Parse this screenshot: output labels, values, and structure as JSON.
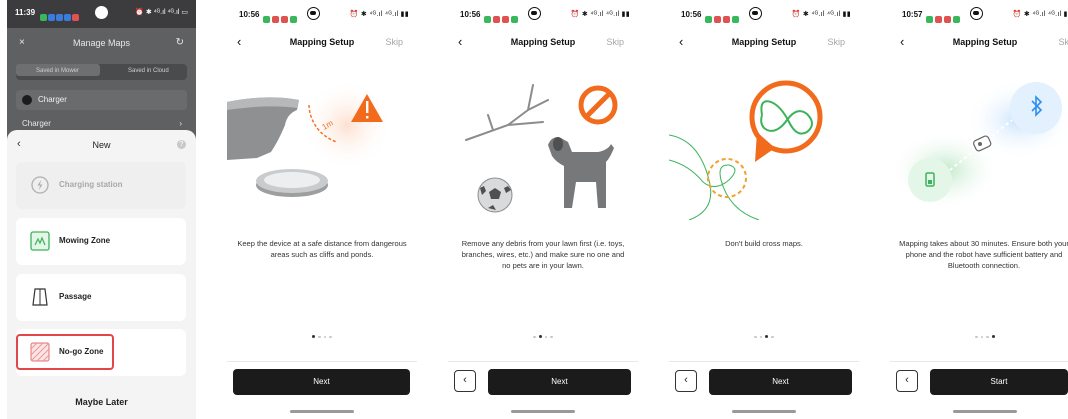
{
  "panel1": {
    "status": {
      "time": "11:39",
      "right": "⏰ ✱ ⁴ᴳ.ıl ⁴ᴳ.ıl ▭"
    },
    "header": {
      "close_icon": "×",
      "title": "Manage Maps",
      "refresh_icon": "↻"
    },
    "segmented": {
      "left": "Saved in Mower",
      "right": "Saved in Cloud"
    },
    "charger_row": {
      "label": "Charger"
    },
    "charger_item": {
      "label": "Charger",
      "arrow": "›"
    },
    "sheet": {
      "back_icon": "‹",
      "title": "New",
      "help_icon": "?",
      "items": [
        {
          "label": "Charging station",
          "icon": "charging-station-icon",
          "enabled": false
        },
        {
          "label": "Mowing Zone",
          "icon": "mowing-zone-icon",
          "enabled": true
        },
        {
          "label": "Passage",
          "icon": "passage-icon",
          "enabled": true
        },
        {
          "label": "No-go Zone",
          "icon": "no-go-zone-icon",
          "enabled": true,
          "highlighted": true
        }
      ],
      "maybe_later": "Maybe Later"
    },
    "colors": {
      "highlight": "#e0464a",
      "mowing_green": "#3cb35a"
    }
  },
  "screens": [
    {
      "status": {
        "time": "10:56",
        "right": "⏰ ✱ ⁴ᴳ.ıl ⁴ᴳ.ıl ▮▮"
      },
      "nav": {
        "back_icon": "‹",
        "title": "Mapping Setup",
        "skip": "Skip"
      },
      "illustration": {
        "badge_text": "1m"
      },
      "description": "Keep the device at a safe distance from dangerous areas such as cliffs and ponds.",
      "page_index": 1,
      "page_count": 4,
      "show_back_button": false,
      "button": "Next"
    },
    {
      "status": {
        "time": "10:56",
        "right": "⏰ ✱ ⁴ᴳ.ıl ⁴ᴳ.ıl ▮▮"
      },
      "nav": {
        "back_icon": "‹",
        "title": "Mapping Setup",
        "skip": "Skip"
      },
      "description": "Remove any debris from your lawn first (i.e. toys, branches, wires, etc.) and make sure no one and no pets are in your lawn.",
      "page_index": 2,
      "page_count": 4,
      "show_back_button": true,
      "back_icon": "‹",
      "button": "Next"
    },
    {
      "status": {
        "time": "10:56",
        "right": "⏰ ✱ ⁴ᴳ.ıl ⁴ᴳ.ıl ▮▮"
      },
      "nav": {
        "back_icon": "‹",
        "title": "Mapping Setup",
        "skip": "Skip"
      },
      "description": "Don't build cross maps.",
      "page_index": 3,
      "page_count": 4,
      "show_back_button": true,
      "back_icon": "‹",
      "button": "Next"
    },
    {
      "status": {
        "time": "10:57",
        "right": "⏰ ✱ ⁴ᴳ.ıl ⁴ᴳ.ıl ▮▮"
      },
      "nav": {
        "back_icon": "‹",
        "title": "Mapping Setup",
        "skip": "Skip"
      },
      "description": "Mapping takes about 30 minutes. Ensure both your phone and the robot have sufficient battery and Bluetooth connection.",
      "page_index": 4,
      "page_count": 4,
      "show_back_button": true,
      "back_icon": "‹",
      "button": "Start"
    }
  ],
  "colors": {
    "warning_orange": "#f26b1d",
    "primary_button": "#1b1b1b",
    "skip_gray": "#a6a6a6",
    "map_green": "#3cb35a",
    "bluetooth_blue": "#2e8ef0"
  }
}
